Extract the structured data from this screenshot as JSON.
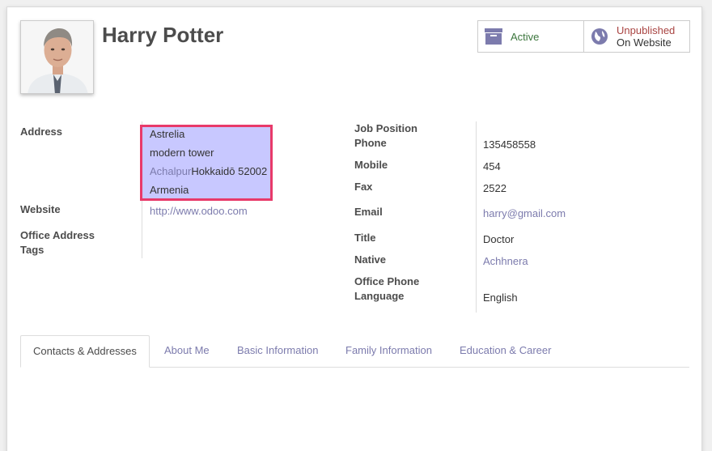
{
  "partner": {
    "name": "Harry Potter"
  },
  "buttons": {
    "active_label": "Active",
    "website_line1": "Unpublished",
    "website_line2": "On Website"
  },
  "left": {
    "address_label": "Address",
    "address": {
      "street": "Astrelia",
      "street2": "modern tower",
      "city": "Achalpur",
      "state_zip": "Hokkaidō 52002",
      "country": "Armenia"
    },
    "website_label": "Website",
    "website": "http://www.odoo.com",
    "office_address_label": "Office Address",
    "tags_label": "Tags"
  },
  "right": {
    "job_position_label": "Job Position",
    "phone_label": "Phone",
    "phone": "135458558",
    "mobile_label": "Mobile",
    "mobile": "454",
    "fax_label": "Fax",
    "fax": "2522",
    "email_label": "Email",
    "email": "harry@gmail.com",
    "title_label": "Title",
    "title": "Doctor",
    "native_label": "Native",
    "native": "Achhnera",
    "office_phone_label": "Office Phone",
    "language_label": "Language",
    "language": "English"
  },
  "tabs": [
    "Contacts & Addresses",
    "About Me",
    "Basic Information",
    "Family Information",
    "Education & Career"
  ],
  "colors": {
    "link": "#7c7bad",
    "active_green": "#3c763d",
    "unpublished_red": "#a94442",
    "highlight_border": "#e83a6a",
    "highlight_fill": "#c8c8ff"
  }
}
